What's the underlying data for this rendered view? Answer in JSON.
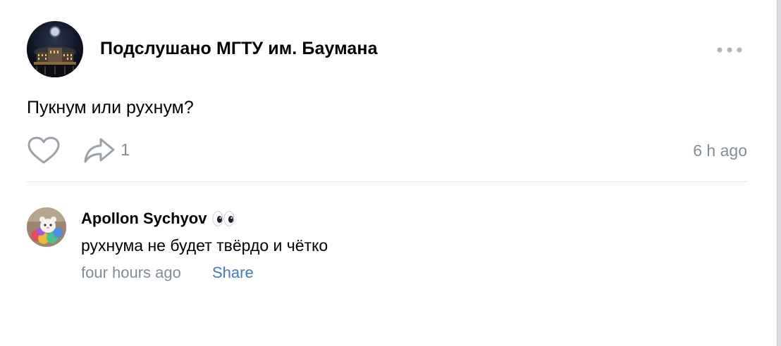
{
  "post": {
    "group_name": "Подслушано МГТУ им. Баумана",
    "text": "Пукнум или рухнум?",
    "share_count": "1",
    "time": "6 h ago",
    "icons": {
      "avatar": "group-avatar-night-building",
      "more": "more-horizontal-icon",
      "like": "heart-icon",
      "share": "share-arrow-icon"
    }
  },
  "comment": {
    "author": "Apollon Sychyov",
    "author_badge_icon": "eyes-emoji-icon",
    "text": "рухнума не будет твёрдо и чётко",
    "time": "four hours ago",
    "share_label": "Share"
  },
  "colors": {
    "secondary_text": "#818c99",
    "link": "#447bba",
    "icon": "#99a2ad",
    "divider": "#e3e4e8"
  }
}
